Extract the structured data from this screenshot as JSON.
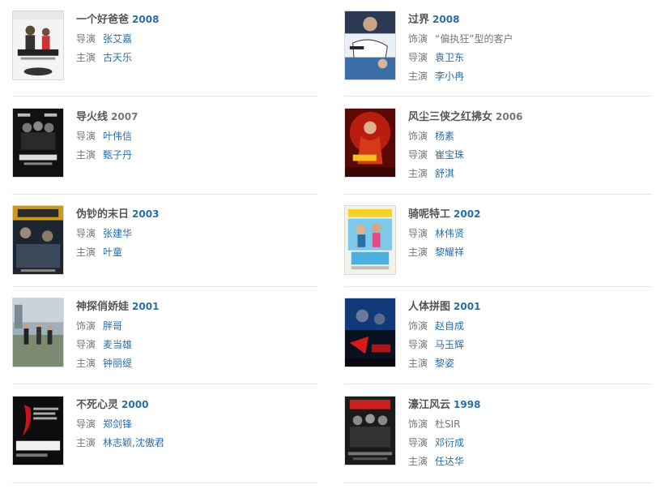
{
  "films": [
    {
      "title": "一个好爸爸",
      "year": "2008",
      "year_link": true,
      "poster": "poster-1",
      "credits": [
        {
          "role": "导演",
          "people": [
            {
              "name": "张艾嘉",
              "link": true
            }
          ]
        },
        {
          "role": "主演",
          "people": [
            {
              "name": "古天乐",
              "link": true
            }
          ]
        }
      ]
    },
    {
      "title": "过界",
      "year": "2008",
      "year_link": true,
      "poster": "poster-2",
      "credits": [
        {
          "role": "饰演",
          "people": [
            {
              "name": "“偏执狂”型的客户",
              "link": false
            }
          ]
        },
        {
          "role": "导演",
          "people": [
            {
              "name": "袁卫东",
              "link": true
            }
          ]
        },
        {
          "role": "主演",
          "people": [
            {
              "name": "李小冉",
              "link": true
            }
          ]
        }
      ]
    },
    {
      "title": "导火线",
      "year": "2007",
      "year_link": false,
      "poster": "poster-3",
      "credits": [
        {
          "role": "导演",
          "people": [
            {
              "name": "叶伟信",
              "link": true
            }
          ]
        },
        {
          "role": "主演",
          "people": [
            {
              "name": "甄子丹",
              "link": true
            }
          ]
        }
      ]
    },
    {
      "title": "风尘三侠之红拂女",
      "year": "2006",
      "year_link": false,
      "poster": "poster-4",
      "credits": [
        {
          "role": "饰演",
          "people": [
            {
              "name": "杨素",
              "link": true
            }
          ]
        },
        {
          "role": "导演",
          "people": [
            {
              "name": "崔宝珠",
              "link": true
            }
          ]
        },
        {
          "role": "主演",
          "people": [
            {
              "name": "舒淇",
              "link": true
            }
          ]
        }
      ]
    },
    {
      "title": "伪钞的末日",
      "year": "2003",
      "year_link": true,
      "poster": "poster-5",
      "credits": [
        {
          "role": "导演",
          "people": [
            {
              "name": "张建华",
              "link": true
            }
          ]
        },
        {
          "role": "主演",
          "people": [
            {
              "name": "叶童",
              "link": true
            }
          ]
        }
      ]
    },
    {
      "title": "骑呢特工",
      "year": "2002",
      "year_link": true,
      "poster": "poster-6",
      "credits": [
        {
          "role": "导演",
          "people": [
            {
              "name": "林伟贤",
              "link": true
            }
          ]
        },
        {
          "role": "主演",
          "people": [
            {
              "name": "黎耀祥",
              "link": true
            }
          ]
        }
      ]
    },
    {
      "title": "神探俏娇娃",
      "year": "2001",
      "year_link": true,
      "poster": "poster-7",
      "credits": [
        {
          "role": "饰演",
          "people": [
            {
              "name": "胖哥",
              "link": true
            }
          ]
        },
        {
          "role": "导演",
          "people": [
            {
              "name": "麦当雄",
              "link": true
            }
          ]
        },
        {
          "role": "主演",
          "people": [
            {
              "name": "钟丽缇",
              "link": true
            }
          ]
        }
      ]
    },
    {
      "title": "人体拼图",
      "year": "2001",
      "year_link": true,
      "poster": "poster-8",
      "credits": [
        {
          "role": "饰演",
          "people": [
            {
              "name": "赵自成",
              "link": true
            }
          ]
        },
        {
          "role": "导演",
          "people": [
            {
              "name": "马玉辉",
              "link": true
            }
          ]
        },
        {
          "role": "主演",
          "people": [
            {
              "name": "黎姿",
              "link": true
            }
          ]
        }
      ]
    },
    {
      "title": "不死心灵",
      "year": "2000",
      "year_link": true,
      "poster": "poster-9",
      "credits": [
        {
          "role": "导演",
          "people": [
            {
              "name": "郑剑锋",
              "link": true
            }
          ]
        },
        {
          "role": "主演",
          "people": [
            {
              "name": "林志颖",
              "link": true
            },
            {
              "name": "沈傲君",
              "link": true
            }
          ]
        }
      ]
    },
    {
      "title": "濠江风云",
      "year": "1998",
      "year_link": true,
      "poster": "poster-10",
      "credits": [
        {
          "role": "饰演",
          "people": [
            {
              "name": "杜SIR",
              "link": false
            }
          ]
        },
        {
          "role": "导演",
          "people": [
            {
              "name": "邓衍成",
              "link": true
            }
          ]
        },
        {
          "role": "主演",
          "people": [
            {
              "name": "任达华",
              "link": true
            }
          ]
        }
      ]
    }
  ],
  "colors": {
    "link": "#2a6ea9",
    "muted": "#777777",
    "title": "#555555",
    "divider": "#e5e5e5"
  },
  "separator": ","
}
